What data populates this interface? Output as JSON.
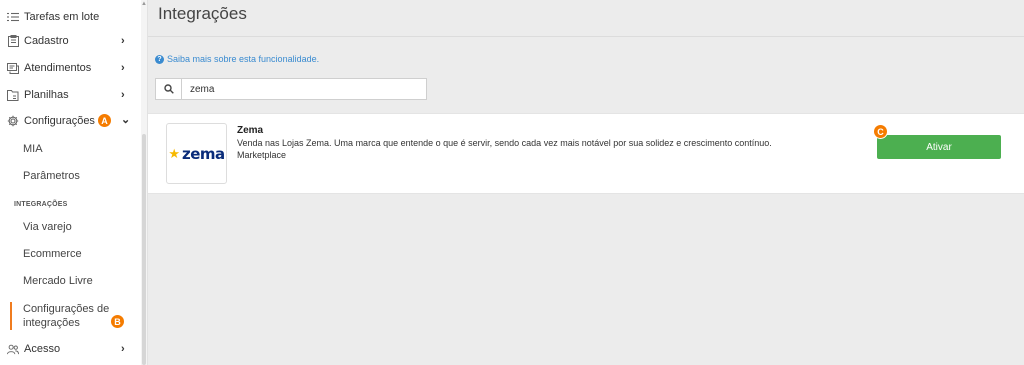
{
  "sidebar": {
    "items": [
      {
        "label": "Tarefas em lote",
        "icon": "list-icon"
      },
      {
        "label": "Cadastro",
        "icon": "clipboard-icon",
        "chevron": "›"
      },
      {
        "label": "Atendimentos",
        "icon": "support-icon",
        "chevron": "›"
      },
      {
        "label": "Planilhas",
        "icon": "spreadsheet-icon",
        "chevron": "›"
      },
      {
        "label": "Configurações",
        "icon": "gear-icon",
        "chevron": "⌄"
      },
      {
        "label": "Acesso",
        "icon": "users-icon",
        "chevron": "›"
      }
    ],
    "config_sub": [
      "MIA",
      "Parâmetros"
    ],
    "section_label": "INTEGRAÇÕES",
    "integration_sub": [
      "Via varejo",
      "Ecommerce",
      "Mercado Livre"
    ],
    "active_sub": {
      "line1": "Configurações de",
      "line2": "integrações"
    }
  },
  "badges": {
    "a": "A",
    "b": "B",
    "c": "C"
  },
  "main": {
    "title": "Integrações",
    "help_icon": "?",
    "help_link": "Saiba mais sobre esta funcionalidade.",
    "search": {
      "value": "zema",
      "placeholder": ""
    },
    "card": {
      "logo_text": "zema",
      "logo_star": "★",
      "name": "Zema",
      "description": "Venda nas Lojas Zema. Uma marca que entende o que é servir, sendo cada vez mais notável por sua solidez e crescimento contínuo.",
      "category": "Marketplace",
      "button": "Ativar"
    }
  },
  "colors": {
    "accent": "#f57c00",
    "button": "#4caf50",
    "link": "#3a8bd0",
    "logo": "#0a2c7a"
  }
}
